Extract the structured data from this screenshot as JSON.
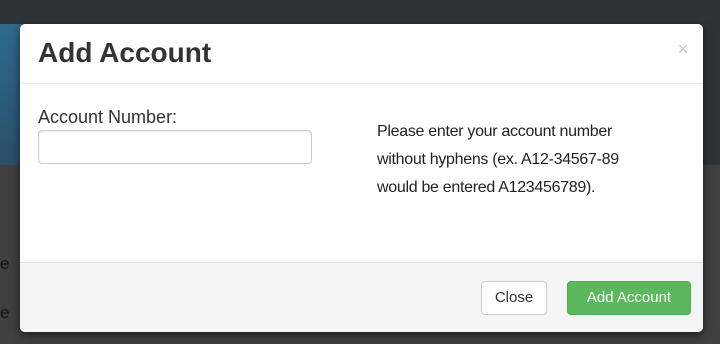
{
  "backdrop": {
    "letter1": "e",
    "letter2": "e"
  },
  "modal": {
    "title": "Add Account",
    "close_icon": "×",
    "field_label": "Account Number:",
    "input_value": "",
    "input_placeholder": "",
    "help_lines": [
      "Please enter your account number",
      "without hyphens (ex. A12-34567-89",
      "would be entered A123456789)."
    ],
    "close_button": "Close",
    "submit_button": "Add Account"
  },
  "colors": {
    "primary_button": "#5cb85c",
    "title_text": "#333333"
  }
}
